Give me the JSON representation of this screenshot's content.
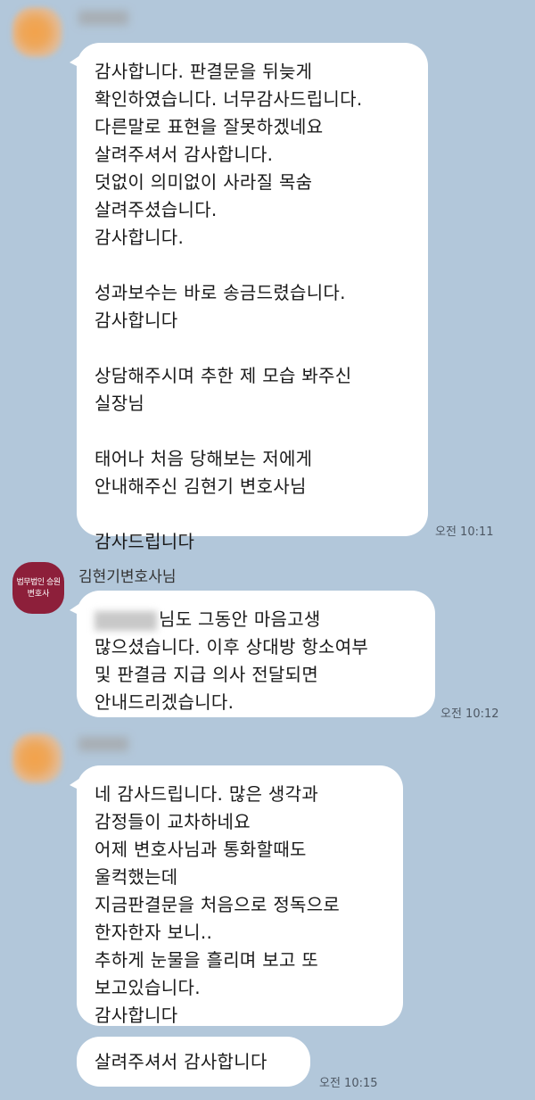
{
  "messages": [
    {
      "sender": "",
      "lines": [
        "감사합니다. 판결문을 뒤늦게",
        "확인하였습니다. 너무감사드립니다.",
        "다른말로 표현을 잘못하겠네요",
        "살려주셔서 감사합니다.",
        "덧없이 의미없이 사라질 목숨",
        "살려주셨습니다.",
        "감사합니다.",
        "",
        "성과보수는 바로 송금드렸습니다.",
        "감사합니다",
        "",
        "상담해주시며 추한 제 모습 봐주신",
        "실장님",
        "",
        "태어나 처음 당해보는 저에게",
        "안내해주신 김현기 변호사님",
        "",
        "감사드립니다"
      ],
      "time": "오전 10:11"
    },
    {
      "sender": "김현기변호사님",
      "avatar_line1": "법무법인 승원",
      "avatar_line2": "변호사",
      "first_line_rest": "님도 그동안 마음고생",
      "lines": [
        "많으셨습니다. 이후 상대방 항소여부",
        "및 판결금 지급 의사 전달되면",
        "안내드리겠습니다."
      ],
      "time": "오전 10:12"
    },
    {
      "sender": "",
      "lines": [
        "네 감사드립니다. 많은 생각과",
        "감정들이 교차하네요",
        "어제 변호사님과 통화할때도",
        "울컥했는데",
        "지금판결문을 처음으로 정독으로",
        "한자한자 보니..",
        "추하게 눈물을 흘리며 보고 또",
        "보고있습니다.",
        "감사합니다"
      ]
    },
    {
      "sender": "",
      "lines": [
        "살려주셔서 감사합니다"
      ],
      "time": "오전 10:15"
    }
  ]
}
